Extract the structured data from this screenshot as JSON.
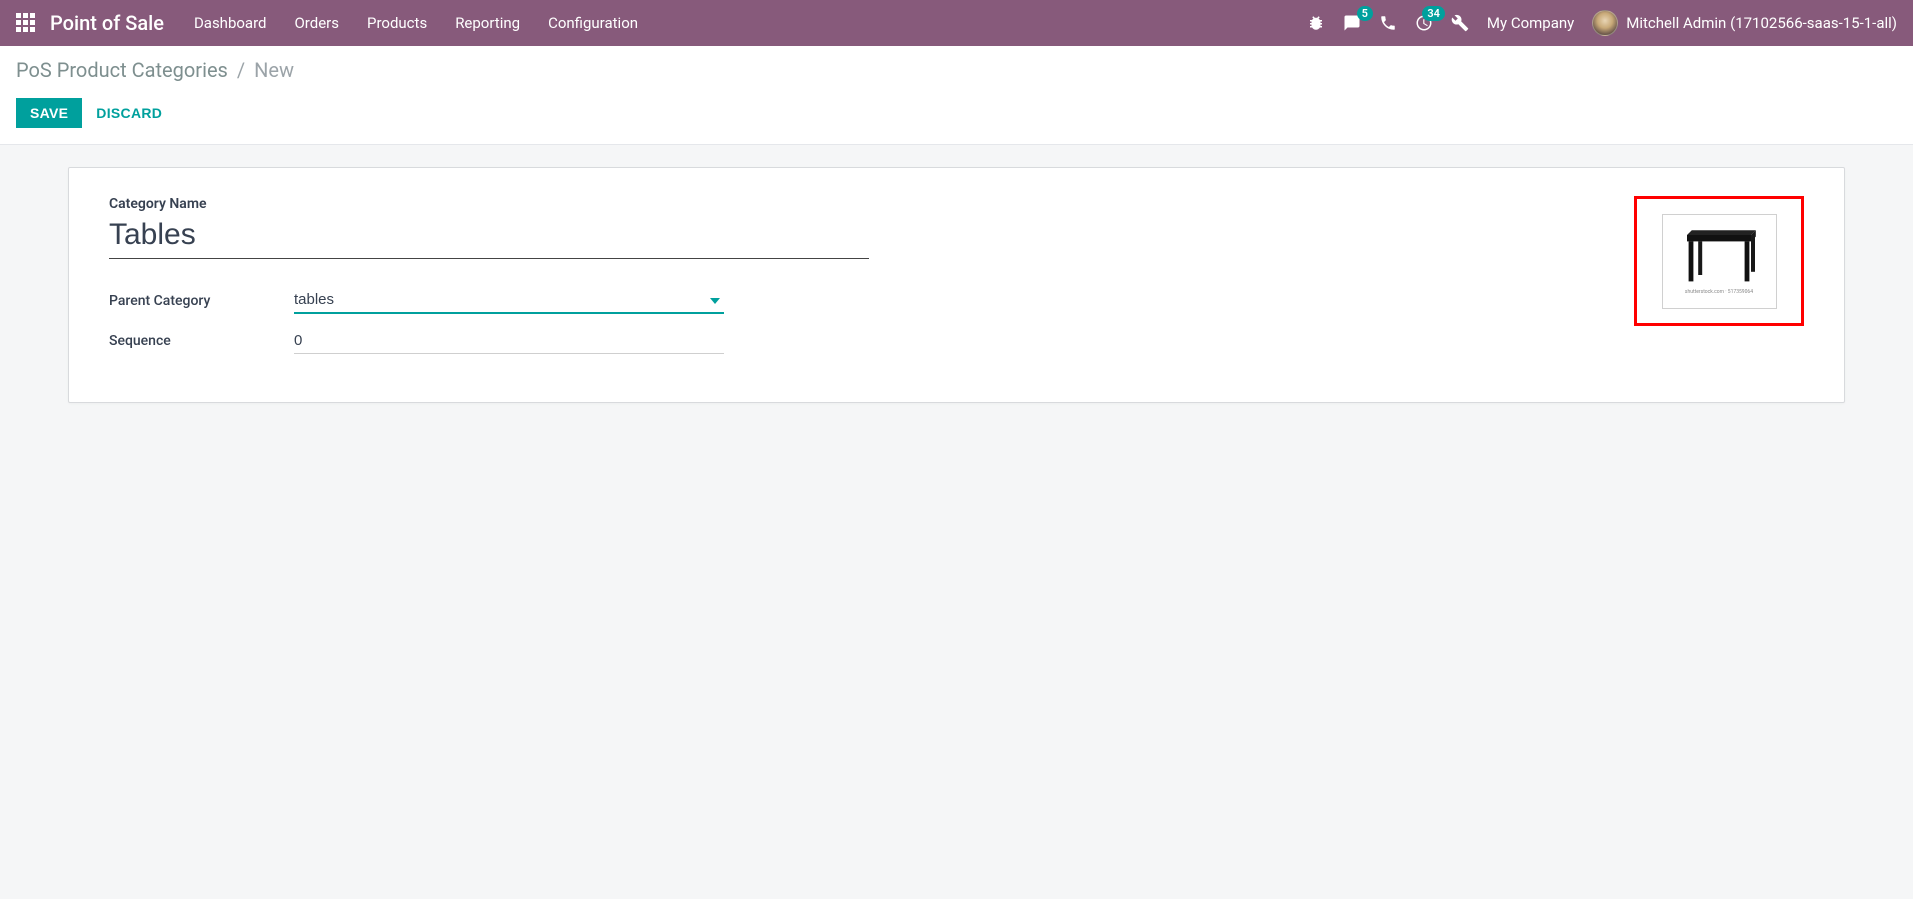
{
  "navbar": {
    "brand": "Point of Sale",
    "items": [
      "Dashboard",
      "Orders",
      "Products",
      "Reporting",
      "Configuration"
    ],
    "chat_badge": "5",
    "activity_badge": "34",
    "company": "My Company",
    "user": "Mitchell Admin (17102566-saas-15-1-all)"
  },
  "breadcrumb": {
    "root": "PoS Product Categories",
    "current": "New"
  },
  "actions": {
    "save": "SAVE",
    "discard": "DISCARD"
  },
  "form": {
    "label_category_name": "Category Name",
    "category_name": "Tables",
    "label_parent_category": "Parent Category",
    "parent_category": "tables",
    "label_sequence": "Sequence",
    "sequence": "0",
    "image_caption": "shutterstock.com · 517359064"
  }
}
